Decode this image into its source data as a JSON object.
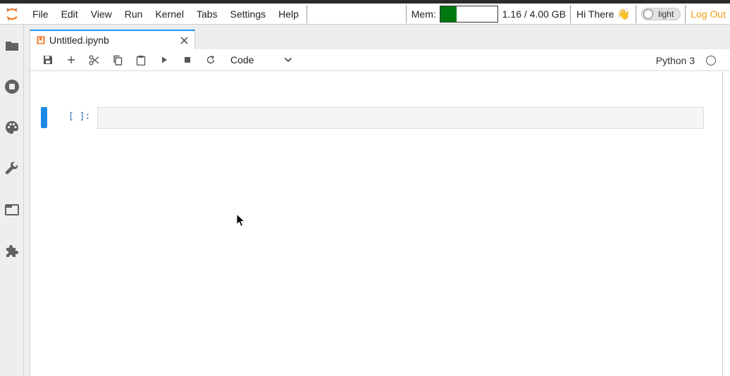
{
  "menubar": {
    "items": [
      "File",
      "Edit",
      "View",
      "Run",
      "Kernel",
      "Tabs",
      "Settings",
      "Help"
    ],
    "mem_label": "Mem:",
    "mem_fraction": 0.29,
    "mem_value": "1.16 / 4.00 GB",
    "greeting": "Hi There",
    "greeting_emoji": "👋",
    "theme_toggle": "light",
    "logout": "Log Out"
  },
  "sidebar": {
    "icons": [
      "folder-icon",
      "stop-circle-icon",
      "palette-icon",
      "wrench-icon",
      "tab-window-icon",
      "puzzle-icon"
    ]
  },
  "tab": {
    "label": "Untitled.ipynb"
  },
  "toolbar": {
    "cell_type": "Code",
    "kernel_name": "Python 3"
  },
  "cell": {
    "prompt": "[ ]:"
  },
  "colors": {
    "accent": "#2196f3",
    "logout": "#f39c12",
    "mem_fill": "#007a10",
    "cell_active": "#1e88e5"
  }
}
